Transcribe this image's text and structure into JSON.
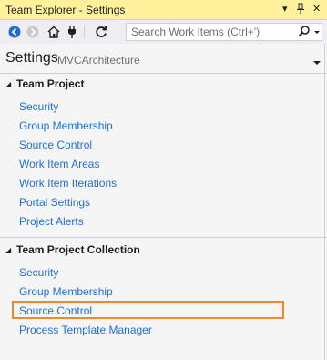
{
  "titlebar": {
    "title": "Team Explorer - Settings",
    "pin_glyph": "▾",
    "pin2_glyph": "⊥",
    "close_glyph": "✕"
  },
  "toolbar": {
    "icons": [
      "back-icon",
      "forward-icon",
      "home-icon",
      "connect-icon",
      "refresh-icon"
    ],
    "search": {
      "placeholder": "Search Work Items (Ctrl+')",
      "value": ""
    }
  },
  "header": {
    "title": "Settings",
    "separator": "|",
    "subtitle": "MVCArchitecture"
  },
  "sections": {
    "project": {
      "title": "Team Project",
      "items": [
        "Security",
        "Group Membership",
        "Source Control",
        "Work Item Areas",
        "Work Item Iterations",
        "Portal Settings",
        "Project Alerts"
      ]
    },
    "collection": {
      "title": "Team Project Collection",
      "items": [
        "Security",
        "Group Membership",
        "Source Control",
        "Process Template Manager"
      ]
    }
  },
  "colors": {
    "titlebar_bg": "#fff29d",
    "link": "#1e6fd4",
    "highlight": "#f0892e"
  }
}
